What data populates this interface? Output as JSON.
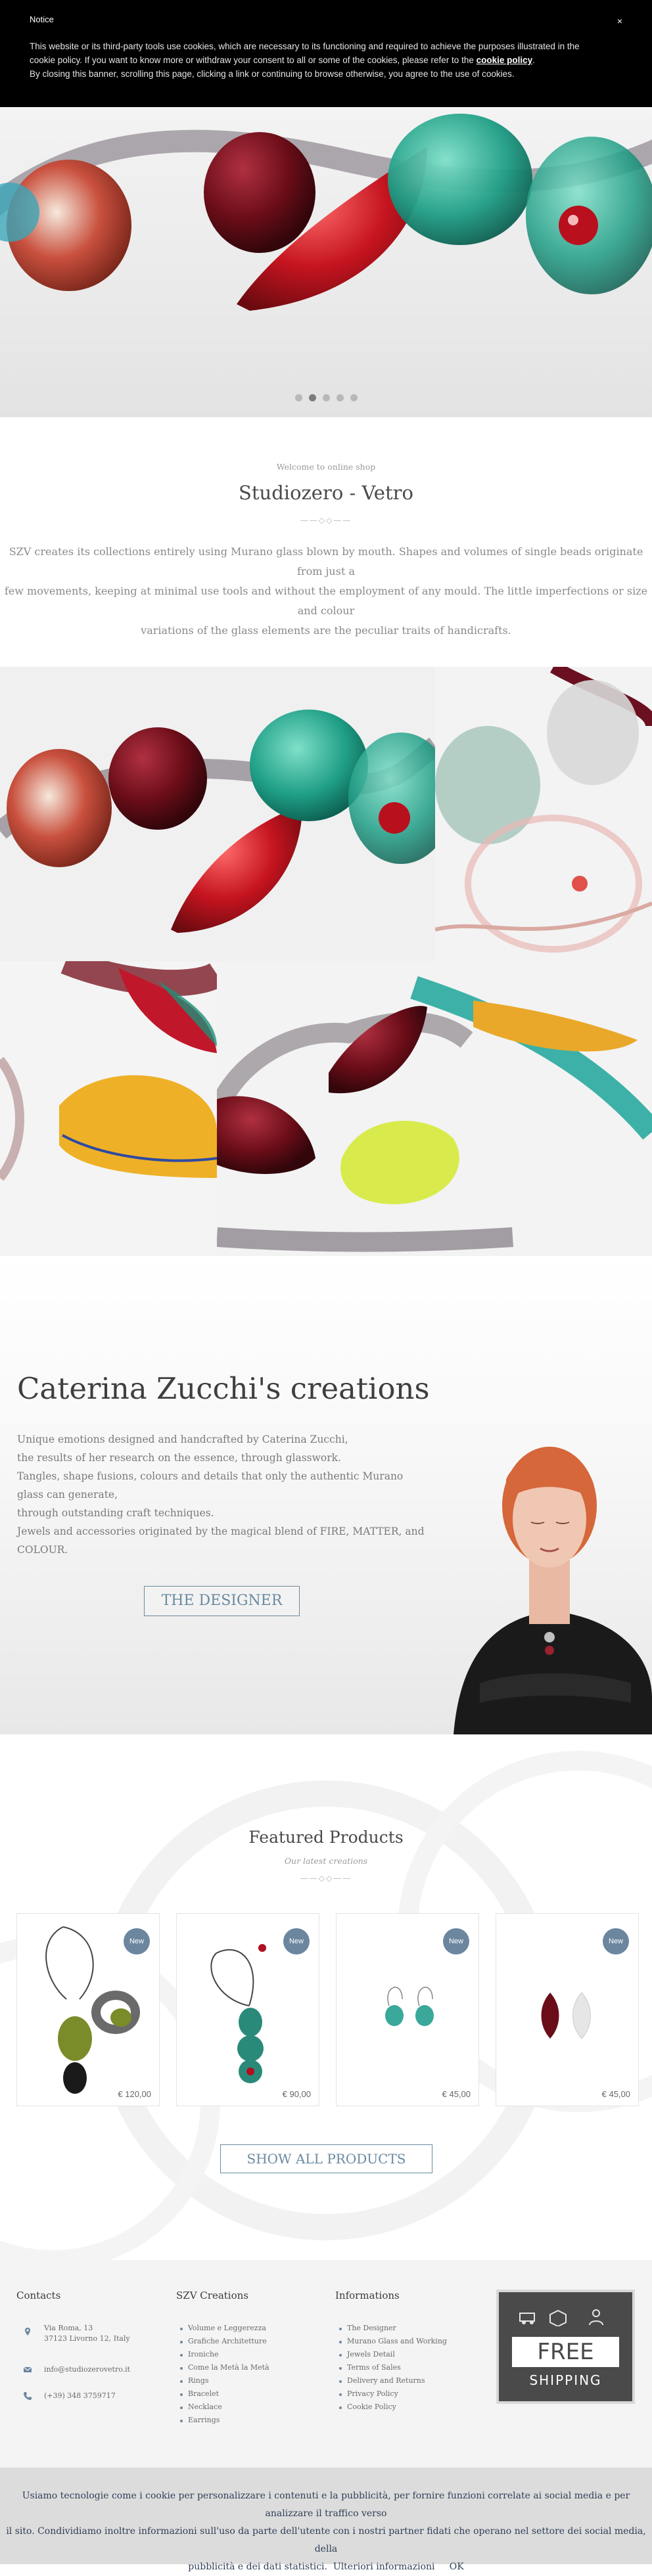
{
  "notice": {
    "title": "Notice",
    "close_glyph": "×",
    "line1": "This website or its third-party tools use cookies, which are necessary to its functioning and required to achieve the purposes illustrated in the",
    "line2_pre": "cookie policy. If you want to know more or withdraw your consent to all or some of the cookies, please refer to the ",
    "line2_link": "cookie policy",
    "line2_post": ".",
    "line3": "By closing this banner, scrolling this page, clicking a link or continuing to browse otherwise, you agree to the use of cookies."
  },
  "hero": {
    "dots": 5,
    "active_dot": 1
  },
  "welcome": {
    "kicker": "Welcome to online shop",
    "title": "Studiozero - Vetro",
    "divider": "——◇◇——",
    "line1": "SZV creates its collections entirely using Murano glass blown by mouth. Shapes and volumes of single beads originate from just a",
    "line2": "few movements, keeping at minimal use tools and without the employment of any mould. The little imperfections or size and colour",
    "line3": "variations of the glass elements are the peculiar traits of handicrafts."
  },
  "designer": {
    "title": "Caterina Zucchi's creations",
    "lines": [
      "Unique emotions designed and handcrafted by Caterina Zucchi,",
      "the results of her research on the essence, through glasswork.",
      "Tangles, shape fusions, colours and details that only the authentic Murano glass can generate,",
      "through outstanding craft techniques.",
      "Jewels and accessories originated by the magical blend of FIRE, MATTER, and COLOUR."
    ],
    "button": "THE DESIGNER"
  },
  "featured": {
    "title": "Featured Products",
    "subtitle": "Our latest creations",
    "divider": "——◇◇——",
    "products": [
      {
        "badge": "New",
        "price": "€ 120,00"
      },
      {
        "badge": "New",
        "price": "€ 90,00"
      },
      {
        "badge": "New",
        "price": "€ 45,00"
      },
      {
        "badge": "New",
        "price": "€ 45,00"
      }
    ],
    "button": "SHOW ALL PRODUCTS"
  },
  "footer": {
    "contacts": {
      "title": "Contacts",
      "address1": "Via Roma, 13",
      "address2": "37123 Livorno 12, Italy",
      "email": "info@studiozerovetro.it",
      "phone": "(+39) 348 3759717"
    },
    "creations": {
      "title": "SZV Creations",
      "items": [
        "Volume e Leggerezza",
        "Grafiche Architetture",
        "Ironiche",
        "Come la Metà la Metà",
        "Rings",
        "Bracelet",
        "Necklace",
        "Earrings"
      ]
    },
    "informations": {
      "title": "Informations",
      "items": [
        "The Designer",
        "Murano Glass and Working",
        "Jewels Detail",
        "Terms of Sales",
        "Delivery and Returns",
        "Privacy Policy",
        "Cookie Policy"
      ]
    },
    "shipping": {
      "line1": "FREE",
      "line2": "SHIPPING"
    }
  },
  "cookie_bottom": {
    "line1": "Usiamo tecnologie come i cookie per personalizzare i contenuti e la pubblicità, per fornire funzioni correlate ai social media e per analizzare il traffico verso",
    "line2": "il sito. Condividiamo inoltre informazioni sull'uso da parte dell'utente con i nostri partner fidati che operano nel settore dei social media, della",
    "line3": "pubblicità e dei dati statistici.",
    "more": "Ulteriori informazioni",
    "ok": "OK"
  },
  "colors": {
    "accent": "#6c86a0",
    "notice_bg": "#000000",
    "footer_bg": "#f4f4f4",
    "cookie_bg": "#dcdcdc"
  }
}
